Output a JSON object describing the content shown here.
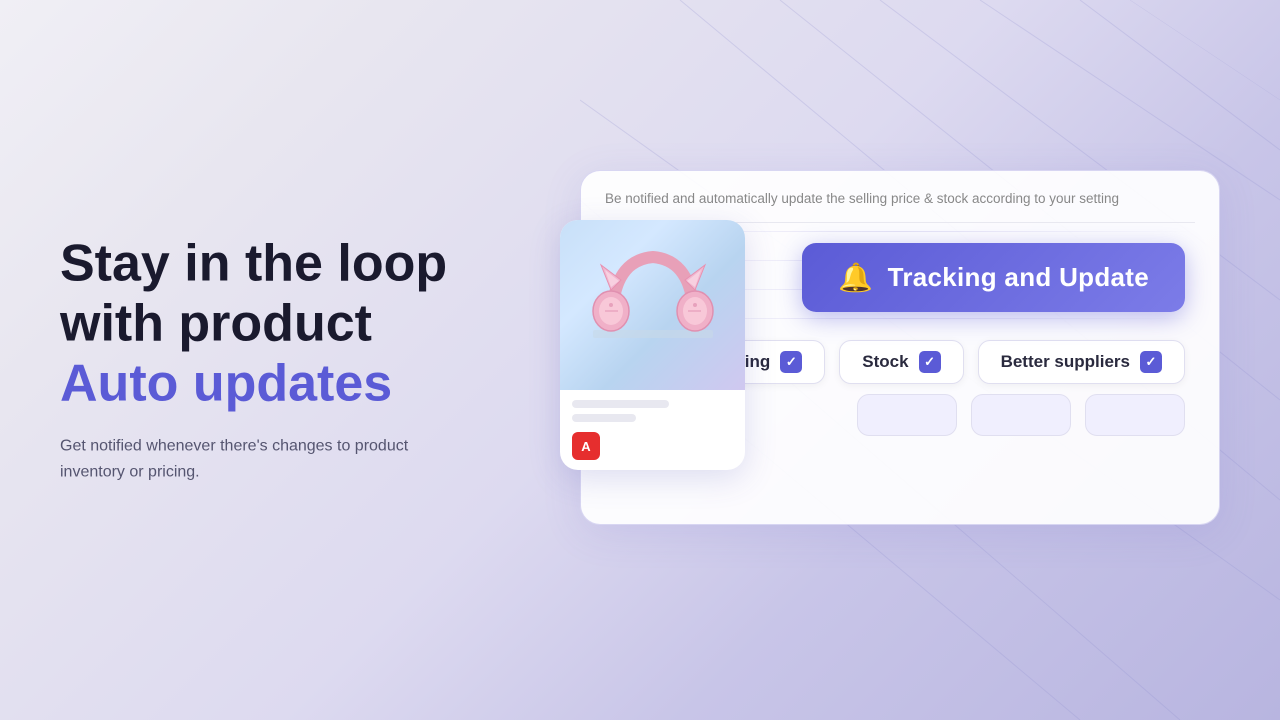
{
  "background": {
    "gradient_start": "#f0eff5",
    "gradient_end": "#b8b5e0"
  },
  "left": {
    "headline_line1": "Stay in the loop",
    "headline_line2": "with product",
    "headline_accent": "Auto updates",
    "subtext": "Get notified whenever there's changes to product inventory or pricing."
  },
  "right": {
    "card_description": "Be notified and automatically update the selling price & stock according to your setting",
    "tracking_button_label": "Tracking and Update",
    "bell_icon": "🔔",
    "pills": [
      {
        "label": "Pricing",
        "checked": true
      },
      {
        "label": "Stock",
        "checked": true
      },
      {
        "label": "Better suppliers",
        "checked": true
      }
    ],
    "arrow_up": "↑",
    "arrow_down": "↓"
  },
  "product_card": {
    "store_badge": "A",
    "image_alt": "Pink cat-ear headphones"
  }
}
